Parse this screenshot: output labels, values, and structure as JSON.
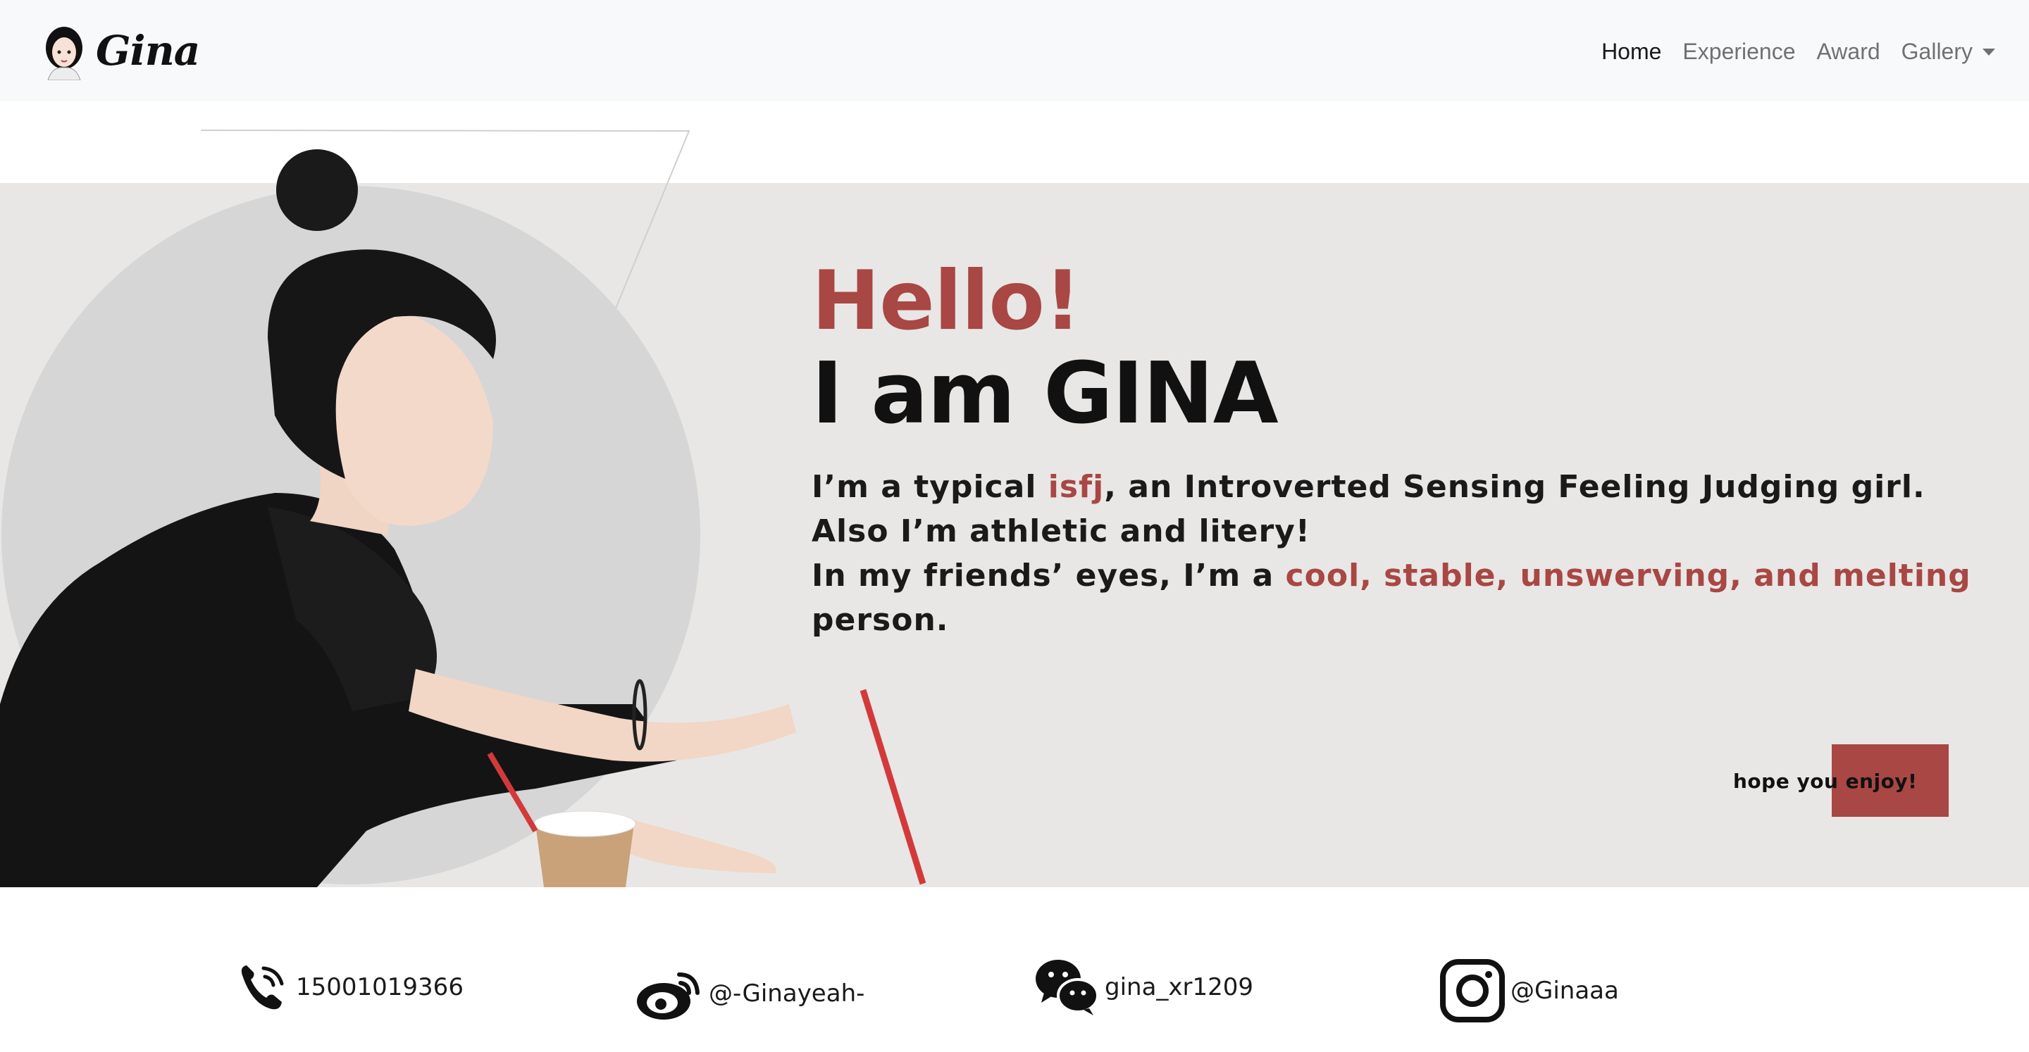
{
  "brand": {
    "name": "Gina",
    "logo_icon": "avatar-icon"
  },
  "nav": {
    "items": [
      {
        "label": "Home",
        "active": true
      },
      {
        "label": "Experience",
        "active": false
      },
      {
        "label": "Award",
        "active": false
      },
      {
        "label": "Gallery",
        "active": false,
        "dropdown": true
      }
    ]
  },
  "hero": {
    "greeting": "Hello!",
    "headline": "I am GINA",
    "line1": {
      "before": "I’m a typical ",
      "highlight": "isfj",
      "after": ", an Introverted Sensing Feeling Judging girl."
    },
    "line2": "Also I’m athletic and litery!",
    "line3": {
      "before": "In my friends’ eyes, I’m a ",
      "highlight": "cool, stable, unswerving, and melting",
      "after": " person."
    },
    "cta": "hope you enjoy!",
    "photo_icon": "portrait-photo"
  },
  "contacts": [
    {
      "icon": "phone-icon",
      "text": "15001019366"
    },
    {
      "icon": "weibo-icon",
      "text": "@-Ginayeah-"
    },
    {
      "icon": "wechat-icon",
      "text": "gina_xr1209"
    },
    {
      "icon": "instagram-icon",
      "text": "@Ginaaa"
    }
  ],
  "colors": {
    "accent": "#a84744",
    "hero_bg": "#e8e7e5",
    "navbar_bg": "#f8f9fa",
    "circle": "#d6d6d6"
  }
}
